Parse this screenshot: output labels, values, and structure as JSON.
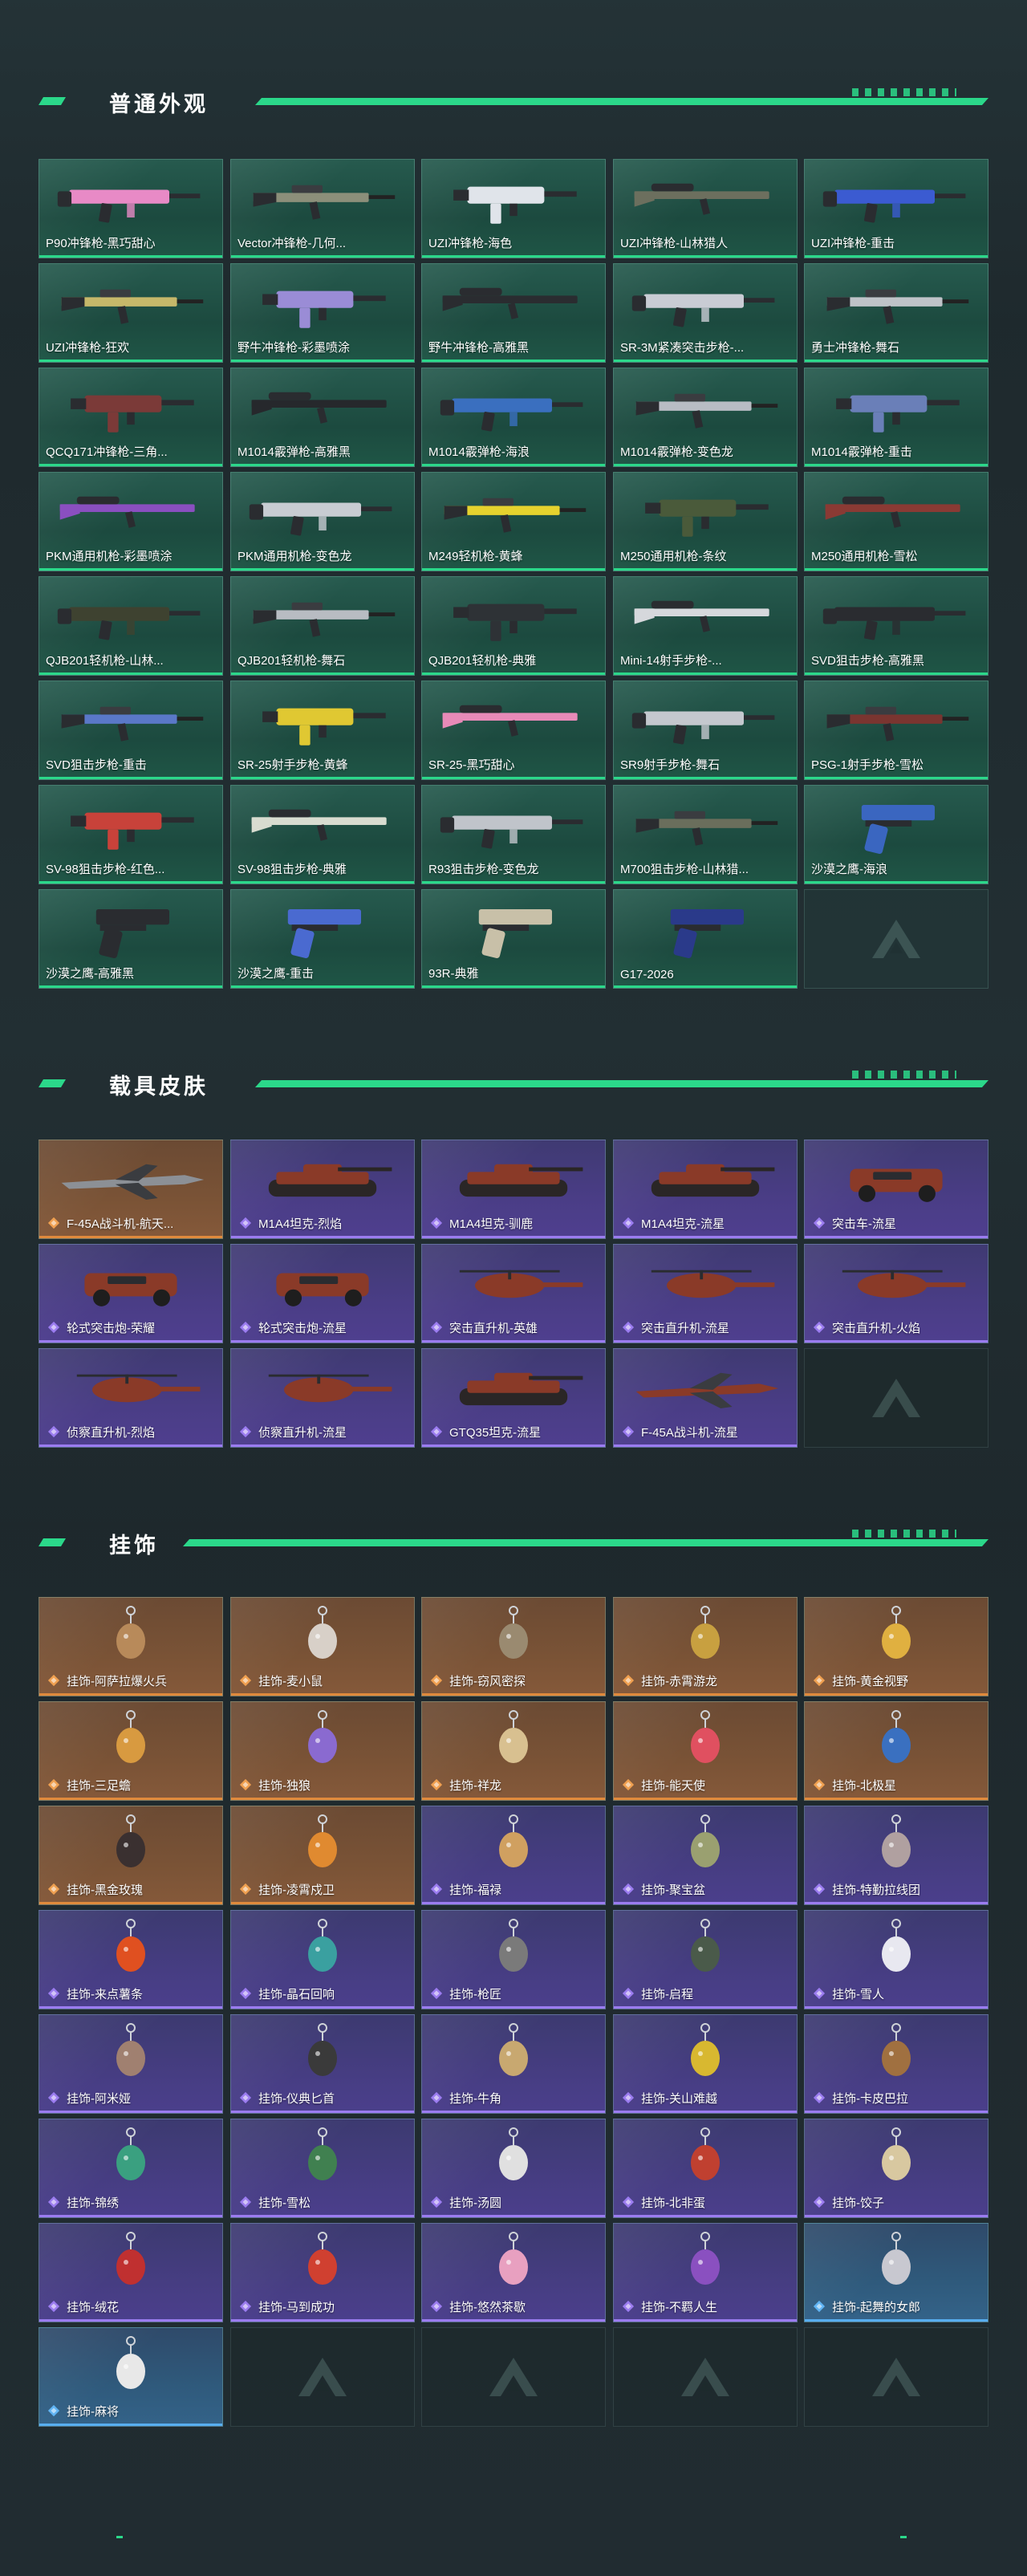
{
  "sections": {
    "weapons": {
      "title": "普通外观",
      "items": [
        {
          "label": "P90冲锋枪-黑巧甜心",
          "color": "#e88ac6"
        },
        {
          "label": "Vector冲锋枪-几何...",
          "color": "#8c8f7a"
        },
        {
          "label": "UZI冲锋枪-海色",
          "color": "#e0e4ea"
        },
        {
          "label": "UZI冲锋枪-山林猎人",
          "color": "#6c6f5e"
        },
        {
          "label": "UZI冲锋枪-重击",
          "color": "#3b5bd1"
        },
        {
          "label": "UZI冲锋枪-狂欢",
          "color": "#c6b86a"
        },
        {
          "label": "野牛冲锋枪-彩墨喷涂",
          "color": "#9a8cd6"
        },
        {
          "label": "野牛冲锋枪-高雅黑",
          "color": "#2a2c30"
        },
        {
          "label": "SR-3M紧凑突击步枪-...",
          "color": "#c9ccd4"
        },
        {
          "label": "勇士冲锋枪-舞石",
          "color": "#bfc3c8"
        },
        {
          "label": "QCQ171冲锋枪-三角...",
          "color": "#7b3a38"
        },
        {
          "label": "M1014霰弹枪-高雅黑",
          "color": "#26282c"
        },
        {
          "label": "M1014霰弹枪-海浪",
          "color": "#3a6fbf"
        },
        {
          "label": "M1014霰弹枪-变色龙",
          "color": "#b8bcc4"
        },
        {
          "label": "M1014霰弹枪-重击",
          "color": "#6a7fb8"
        },
        {
          "label": "PKM通用机枪-彩墨喷涂",
          "color": "#8a4fc0"
        },
        {
          "label": "PKM通用机枪-变色龙",
          "color": "#c8ccd2"
        },
        {
          "label": "M249轻机枪-黄蜂",
          "color": "#e6d22e"
        },
        {
          "label": "M250通用机枪-条纹",
          "color": "#4a5a3a"
        },
        {
          "label": "M250通用机枪-雪松",
          "color": "#8a3a34"
        },
        {
          "label": "QJB201轻机枪-山林...",
          "color": "#3e4230"
        },
        {
          "label": "QJB201轻机枪-舞石",
          "color": "#b8bcc2"
        },
        {
          "label": "QJB201轻机枪-典雅",
          "color": "#2e3236"
        },
        {
          "label": "Mini-14射手步枪-...",
          "color": "#d6d8dc"
        },
        {
          "label": "SVD狙击步枪-高雅黑",
          "color": "#2a2c30"
        },
        {
          "label": "SVD狙击步枪-重击",
          "color": "#5a78c8"
        },
        {
          "label": "SR-25射手步枪-黄蜂",
          "color": "#e0c832"
        },
        {
          "label": "SR-25-黑巧甜心",
          "color": "#e88ab8"
        },
        {
          "label": "SR9射手步枪-舞石",
          "color": "#c4c8ce"
        },
        {
          "label": "PSG-1射手步枪-雪松",
          "color": "#7a3530"
        },
        {
          "label": "SV-98狙击步枪-红色...",
          "color": "#c8423a"
        },
        {
          "label": "SV-98狙击步枪-典雅",
          "color": "#d8dcd0"
        },
        {
          "label": "R93狙击步枪-变色龙",
          "color": "#c0c4ca"
        },
        {
          "label": "M700狙击步枪-山林猎...",
          "color": "#6a6e5c"
        },
        {
          "label": "沙漠之鹰-海浪",
          "color": "#3a66c0"
        },
        {
          "label": "沙漠之鹰-高雅黑",
          "color": "#2a2c30"
        },
        {
          "label": "沙漠之鹰-重击",
          "color": "#4a6ad0"
        },
        {
          "label": "93R-典雅",
          "color": "#c8c0a8"
        },
        {
          "label": "G17-2026",
          "color": "#2a3a8a"
        }
      ]
    },
    "vehicles": {
      "title": "载具皮肤",
      "items": [
        {
          "label": "F-45A战斗机-航天...",
          "rarity": "orange"
        },
        {
          "label": "M1A4坦克-烈焰",
          "rarity": "purple"
        },
        {
          "label": "M1A4坦克-驯鹿",
          "rarity": "purple"
        },
        {
          "label": "M1A4坦克-流星",
          "rarity": "purple"
        },
        {
          "label": "突击车-流星",
          "rarity": "purple"
        },
        {
          "label": "轮式突击炮-荣耀",
          "rarity": "purple"
        },
        {
          "label": "轮式突击炮-流星",
          "rarity": "purple"
        },
        {
          "label": "突击直升机-英雄",
          "rarity": "purple"
        },
        {
          "label": "突击直升机-流星",
          "rarity": "purple"
        },
        {
          "label": "突击直升机-火焰",
          "rarity": "purple"
        },
        {
          "label": "侦察直升机-烈焰",
          "rarity": "purple"
        },
        {
          "label": "侦察直升机-流星",
          "rarity": "purple"
        },
        {
          "label": "GTQ35坦克-流星",
          "rarity": "purple"
        },
        {
          "label": "F-45A战斗机-流星",
          "rarity": "purple"
        }
      ]
    },
    "charms": {
      "title": "挂饰",
      "items": [
        {
          "label": "挂饰-阿萨拉爆火兵",
          "rarity": "orange"
        },
        {
          "label": "挂饰-麦小鼠",
          "rarity": "orange"
        },
        {
          "label": "挂饰-窃风密探",
          "rarity": "orange"
        },
        {
          "label": "挂饰-赤霄游龙",
          "rarity": "orange"
        },
        {
          "label": "挂饰-黄金视野",
          "rarity": "orange"
        },
        {
          "label": "挂饰-三足蟾",
          "rarity": "orange"
        },
        {
          "label": "挂饰-独狼",
          "rarity": "orange"
        },
        {
          "label": "挂饰-祥龙",
          "rarity": "orange"
        },
        {
          "label": "挂饰-能天使",
          "rarity": "orange"
        },
        {
          "label": "挂饰-北极星",
          "rarity": "orange"
        },
        {
          "label": "挂饰-黑金玫瑰",
          "rarity": "orange"
        },
        {
          "label": "挂饰-凌霄戍卫",
          "rarity": "orange"
        },
        {
          "label": "挂饰-福禄",
          "rarity": "purple"
        },
        {
          "label": "挂饰-聚宝盆",
          "rarity": "purple"
        },
        {
          "label": "挂饰-特勤拉线团",
          "rarity": "purple"
        },
        {
          "label": "挂饰-来点薯条",
          "rarity": "purple"
        },
        {
          "label": "挂饰-晶石回响",
          "rarity": "purple"
        },
        {
          "label": "挂饰-枪匠",
          "rarity": "purple"
        },
        {
          "label": "挂饰-启程",
          "rarity": "purple"
        },
        {
          "label": "挂饰-雪人",
          "rarity": "purple"
        },
        {
          "label": "挂饰-阿米娅",
          "rarity": "purple"
        },
        {
          "label": "挂饰-仪典匕首",
          "rarity": "purple"
        },
        {
          "label": "挂饰-牛角",
          "rarity": "purple"
        },
        {
          "label": "挂饰-关山难越",
          "rarity": "purple"
        },
        {
          "label": "挂饰-卡皮巴拉",
          "rarity": "purple"
        },
        {
          "label": "挂饰-锦绣",
          "rarity": "purple"
        },
        {
          "label": "挂饰-雪松",
          "rarity": "purple"
        },
        {
          "label": "挂饰-汤圆",
          "rarity": "purple"
        },
        {
          "label": "挂饰-北非蛋",
          "rarity": "purple"
        },
        {
          "label": "挂饰-饺子",
          "rarity": "purple"
        },
        {
          "label": "挂饰-绒花",
          "rarity": "purple"
        },
        {
          "label": "挂饰-马到成功",
          "rarity": "purple"
        },
        {
          "label": "挂饰-悠然茶歇",
          "rarity": "purple"
        },
        {
          "label": "挂饰-不羁人生",
          "rarity": "purple"
        },
        {
          "label": "挂饰-起舞的女郎",
          "rarity": "blue"
        },
        {
          "label": "挂饰-麻将",
          "rarity": "blue"
        }
      ]
    }
  }
}
